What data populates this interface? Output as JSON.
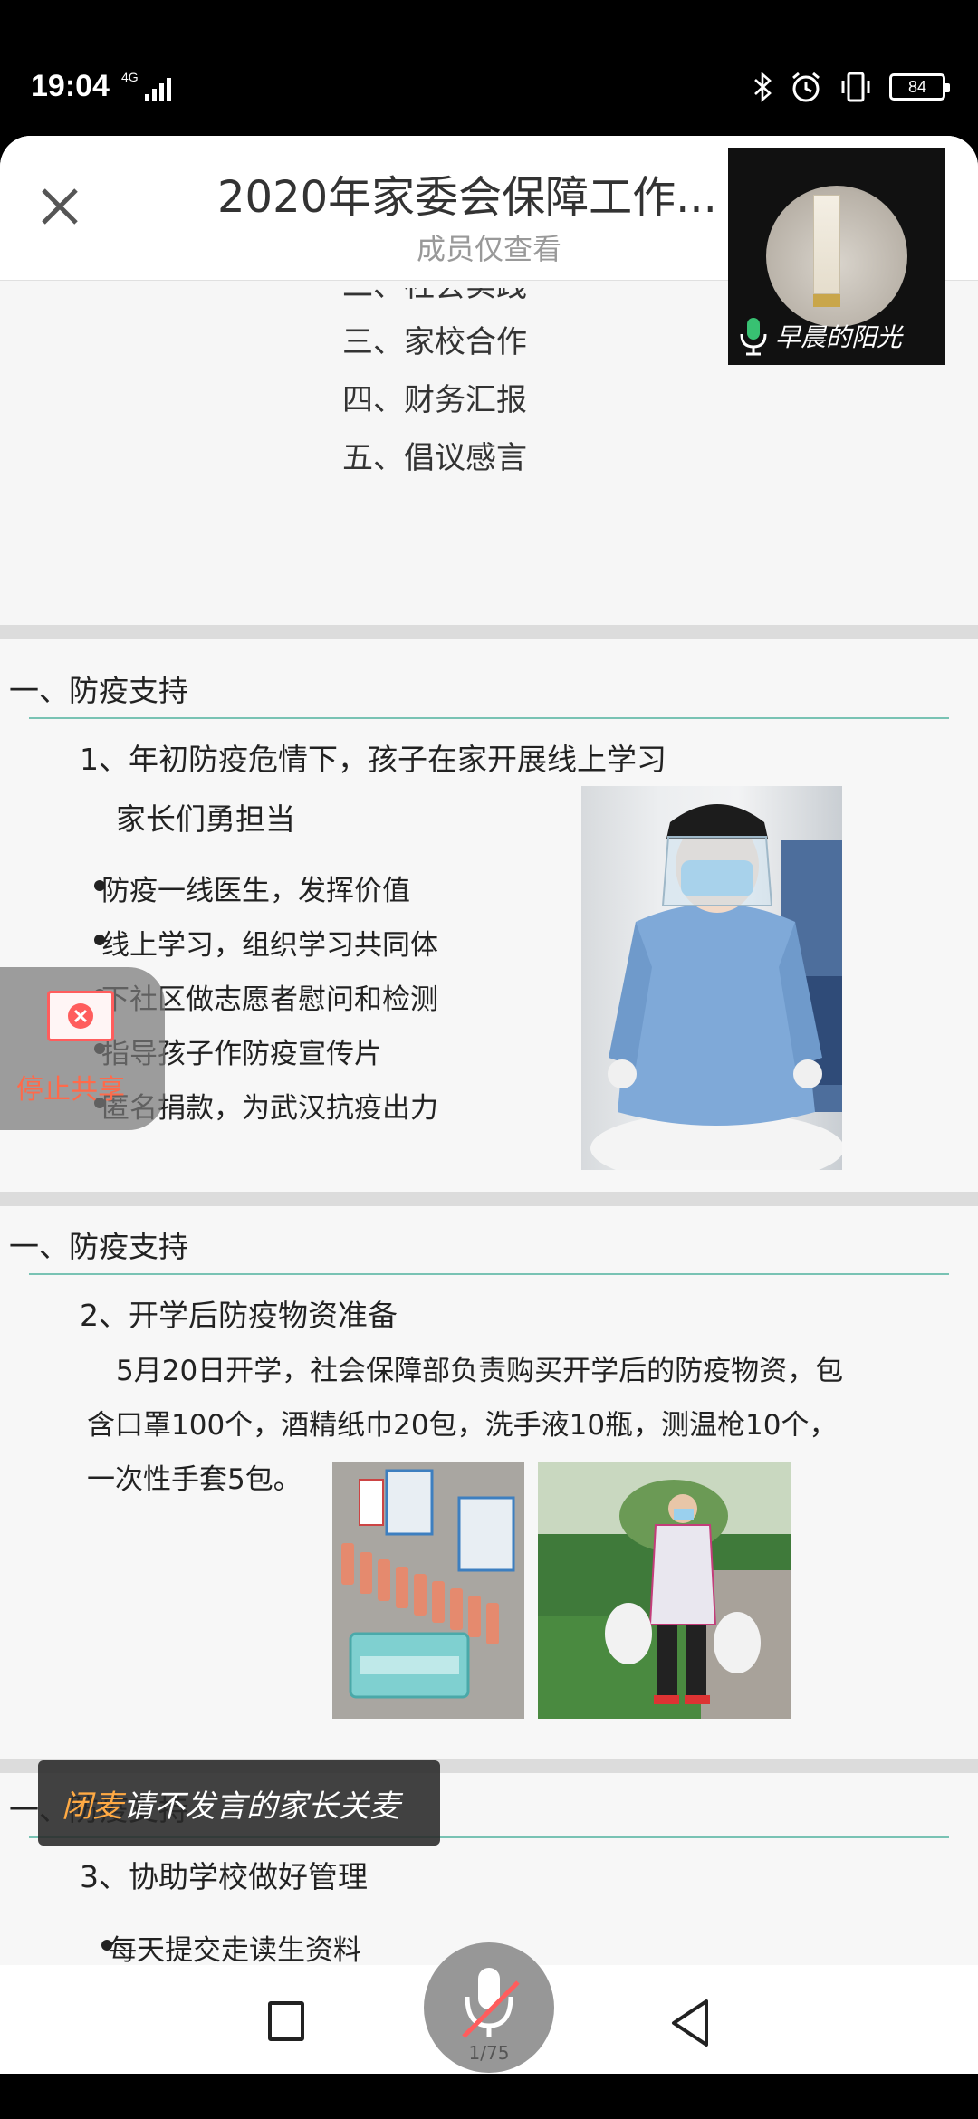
{
  "status_bar": {
    "time": "19:04",
    "network": "4G",
    "battery": "84"
  },
  "header": {
    "title": "2020年家委会保障工作...",
    "subtitle": "成员仅查看"
  },
  "toc": {
    "partial": "二、社会实践",
    "items": [
      "三、家校合作",
      "四、财务汇报",
      "五、倡议感言"
    ]
  },
  "slide2": {
    "heading": "一、防疫支持",
    "sub": "1、年初防疫危情下，孩子在家开展线上学习",
    "sub2": "家长们勇担当",
    "bullets": [
      "防疫一线医生，发挥价值",
      "线上学习，组织学习共同体",
      "下社区做志愿者慰问和检测",
      "指导孩子作防疫宣传片",
      "匿名捐款，为武汉抗疫出力"
    ]
  },
  "slide3": {
    "heading": "一、防疫支持",
    "sub": "2、开学后防疫物资准备",
    "para_lines": [
      "5月20日开学，社会保障部负责购买开学后的防疫物资，包",
      "含口罩100个，酒精纸巾20包，洗手液10瓶，测温枪10个，",
      "一次性手套5包。"
    ]
  },
  "slide4": {
    "heading": "一、防疫支持",
    "sub": "3、协助学校做好管理",
    "bullets": [
      "每天提交走读生资料"
    ]
  },
  "video_tile": {
    "speaker": "早晨的阳光"
  },
  "stop_share": {
    "label": "停止共享"
  },
  "toast": {
    "warn": "闭麦",
    "text": "请不发言的家长关麦"
  },
  "mic": {
    "count": "1/75"
  },
  "colors": {
    "accent_rule": "#79c3b4",
    "mic_green": "#38c172",
    "stop_red": "#ff5d5d"
  }
}
